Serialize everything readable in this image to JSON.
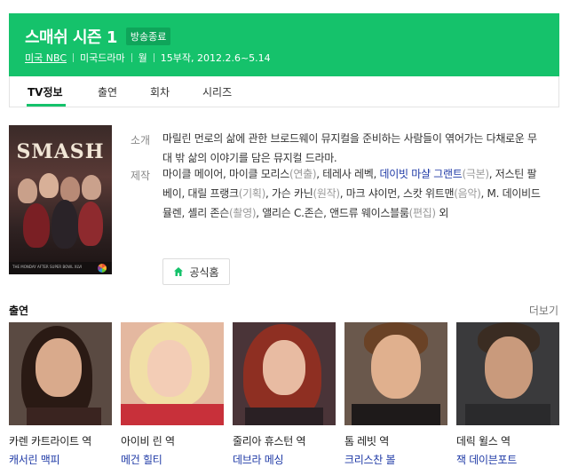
{
  "header": {
    "title": "스매쉬 시즌 1",
    "status": "방송종료",
    "network": "미국 NBC",
    "genre": "미국드라마",
    "day": "월",
    "episodes": "15부작, 2012.2.6~5.14"
  },
  "tabs": [
    "TV정보",
    "출연",
    "회차",
    "시리즈"
  ],
  "poster": {
    "title": "SMASH",
    "tagline": "THE MONDAY AFTER SUPER BOWL XLVI"
  },
  "info": {
    "synopsis_label": "소개",
    "synopsis": "마릴린 먼로의 삶에 관한 브로드웨이 뮤지컬을 준비하는 사람들이 엮어가는 다채로운 무대 밖 삶의 이야기를 담은 뮤지컬 드라마.",
    "production_label": "제작",
    "production": [
      {
        "name": "마이클 메이어",
        "role": ""
      },
      {
        "name": "마이클 모리스",
        "role": "(연출)"
      },
      {
        "name": "테레사 레벡",
        "role": ""
      },
      {
        "name": "데이빗 마샬 그랜트",
        "role": "(극본)",
        "link": true
      },
      {
        "name": "저스틴 팔베이",
        "role": ""
      },
      {
        "name": "대릴 프랭크",
        "role": "(기획)"
      },
      {
        "name": "가슨 카닌",
        "role": "(원작)"
      },
      {
        "name": "마크 샤이먼",
        "role": ""
      },
      {
        "name": "스캇 위트맨",
        "role": "(음악)"
      },
      {
        "name": "M. 데이비드 뮬렌",
        "role": ""
      },
      {
        "name": "셸리 존슨",
        "role": "(촬영)"
      },
      {
        "name": "앨리슨 C.존슨",
        "role": ""
      },
      {
        "name": "앤드류 웨이스블룸",
        "role": "(편집)"
      }
    ],
    "production_suffix": "외"
  },
  "homepage_button": "공식홈",
  "cast": {
    "title": "출연",
    "more": "더보기",
    "members": [
      {
        "role": "카렌 카트라이트 역",
        "actor": "캐서린 맥피"
      },
      {
        "role": "아이비 린 역",
        "actor": "메건 힐티"
      },
      {
        "role": "줄리아 휴스턴 역",
        "actor": "데브라 메싱"
      },
      {
        "role": "톰 레빗 역",
        "actor": "크리스찬 볼"
      },
      {
        "role": "데릭 윌스 역",
        "actor": "잭 데이븐포트"
      }
    ]
  },
  "colors": {
    "brand_green": "#15c26b",
    "link_blue": "#1f3aa6"
  }
}
